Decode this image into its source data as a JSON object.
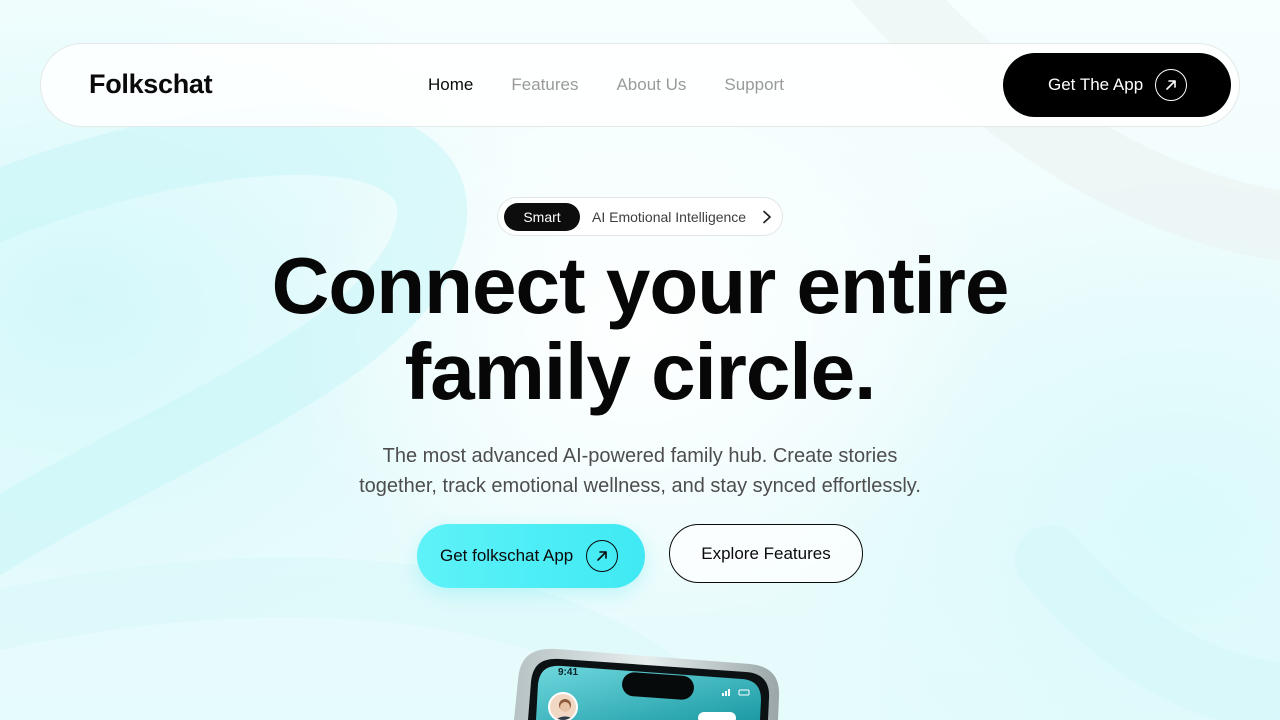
{
  "nav": {
    "logo": "Folkschat",
    "links": [
      {
        "label": "Home",
        "active": true
      },
      {
        "label": "Features",
        "active": false
      },
      {
        "label": "About Us",
        "active": false
      },
      {
        "label": "Support",
        "active": false
      }
    ],
    "cta_label": "Get The App",
    "cta_icon": "arrow-up-right-icon"
  },
  "hero": {
    "badge": {
      "pill": "Smart",
      "text": "AI Emotional Intelligence",
      "icon": "chevron-right-icon"
    },
    "headline_line1": "Connect your entire",
    "headline_line2": "family circle.",
    "subtitle_line1": "The most advanced AI-powered family hub. Create stories",
    "subtitle_line2": "together, track emotional wellness, and stay synced effortlessly.",
    "primary_button": "Get folkschat App",
    "secondary_button": "Explore Features"
  },
  "phone": {
    "time": "9:41"
  },
  "colors": {
    "accent_cyan": "#4eeef6",
    "dark": "#000000",
    "muted_link": "#9a9a9a"
  }
}
